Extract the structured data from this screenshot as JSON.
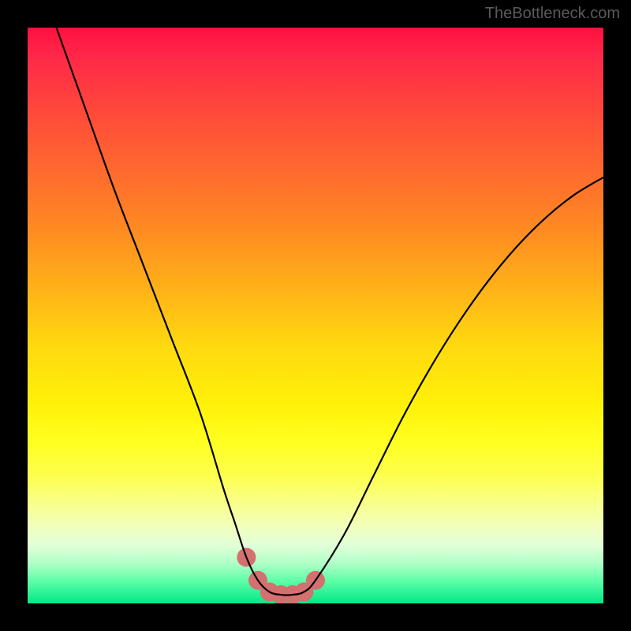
{
  "watermark": "TheBottleneck.com",
  "chart_data": {
    "type": "line",
    "title": "",
    "xlabel": "",
    "ylabel": "",
    "xlim": [
      0,
      100
    ],
    "ylim": [
      0,
      100
    ],
    "series": [
      {
        "name": "bottleneck-curve",
        "x": [
          5,
          10,
          15,
          20,
          25,
          30,
          34,
          36,
          38,
          40,
          42,
          44,
          46,
          48,
          50,
          55,
          60,
          65,
          70,
          75,
          80,
          85,
          90,
          95,
          100
        ],
        "values": [
          100,
          86,
          72,
          59,
          46,
          33,
          20,
          14,
          8,
          4,
          2,
          1.5,
          1.5,
          2,
          4,
          12,
          22,
          32,
          41,
          49,
          56,
          62,
          67,
          71,
          74
        ]
      }
    ],
    "markers": {
      "name": "highlight-dots",
      "x": [
        38,
        40,
        42,
        44,
        46,
        48,
        50
      ],
      "values": [
        8,
        4,
        2,
        1.5,
        1.5,
        2,
        4
      ],
      "color": "#d47070",
      "radius": 12
    },
    "gradient_stops_percent_to_color": [
      [
        0,
        "#ff1040"
      ],
      [
        15,
        "#ff4a3a"
      ],
      [
        35,
        "#ff8a22"
      ],
      [
        55,
        "#ffd810"
      ],
      [
        72,
        "#ffff20"
      ],
      [
        87,
        "#f0ffc0"
      ],
      [
        100,
        "#00e888"
      ]
    ]
  }
}
